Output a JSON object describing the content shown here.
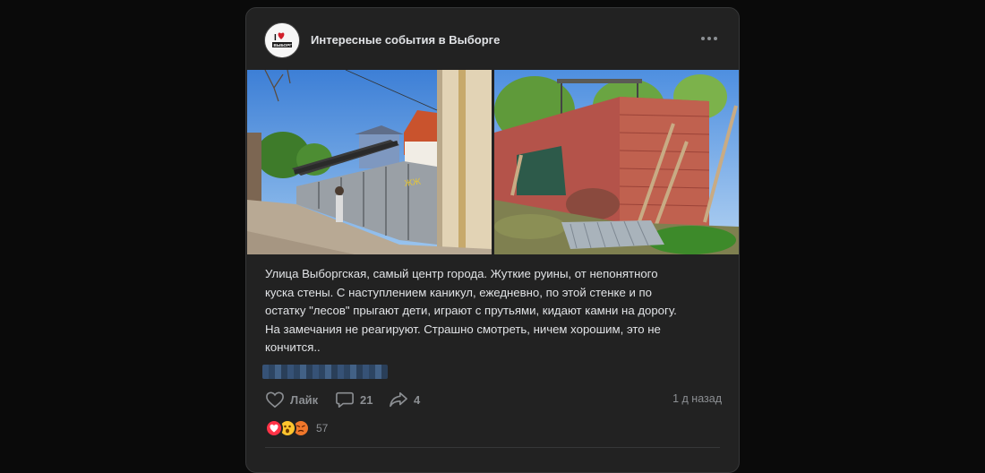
{
  "post": {
    "group_name": "Интересные события в Выборге",
    "avatar_text": "I ♥ ВЫБОРГ",
    "text_lines": [
      "Улица Выборгская, самый центр города. Жуткие руины, от непонятного",
      "куска стены. С наступлением каникул, ежедневно, по этой стенке и по",
      "остатку \"лесов\" прыгают дети, играют с прутьями, кидают камни на дорогу.",
      "На замечания не реагируют. Страшно смотреть, ничем хорошим, это не",
      "кончится.."
    ],
    "time": "1 д назад"
  },
  "actions": {
    "like_label": "Лайк",
    "comments_count": "21",
    "shares_count": "4"
  },
  "reactions": {
    "count": "57",
    "icons": [
      "heart-reaction",
      "wow-reaction",
      "angry-reaction"
    ]
  },
  "colors": {
    "card_bg": "#222222",
    "page_bg": "#0a0a0a",
    "text": "#e1e3e6",
    "secondary": "#8c8f93"
  }
}
